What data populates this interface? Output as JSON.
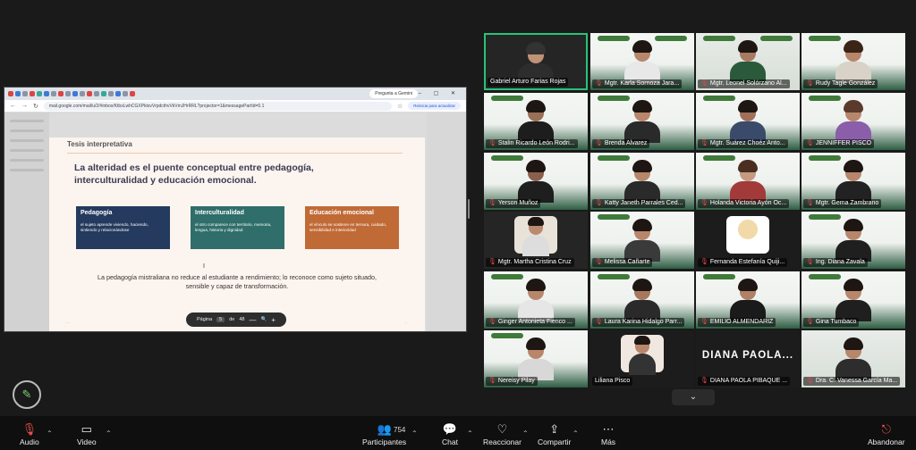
{
  "share": {
    "gemini_label": "Pregunta a Gemini",
    "url": "mail.google.com/mail/u/2/#inbox/KtbxLwhCGXPktsvVrpdcthvVkVmJHrRRL?projector=1&messagePartId=0.1",
    "update_label": "Reinicia para actualizar",
    "slide": {
      "kicker": "Tesis interpretativa",
      "headline": "La alteridad es el puente conceptual entre pedagogía, interculturalidad y educación emocional.",
      "cards": [
        {
          "title": "Pedagogía",
          "text": "el sujeto aprende viviendo, haciendo, sintiendo y relacionándose"
        },
        {
          "title": "Interculturalidad",
          "text": "el otro comparece con territorio, memoria, lengua, historia y dignidad"
        },
        {
          "title": "Educación emocional",
          "text": "el vínculo se sostiene en ternura, cuidado, sensibilidad e interioridad"
        }
      ],
      "footer": "La pedagogía mistraliana no reduce al estudiante a rendimiento; lo reconoce como sujeto situado, sensible y capaz de transformación."
    },
    "pager": {
      "label": "Página",
      "current": "5",
      "of": "de",
      "total": "48",
      "minus": "—",
      "zoom": "🔍",
      "plus": "+"
    }
  },
  "participants": [
    {
      "name": "Gabriel Arturo Farias Rojas",
      "muted": false
    },
    {
      "name": "Mgtr. Karla Sornoza Jara...",
      "muted": true
    },
    {
      "name": "Mgtr. Leonel Solórzano Al...",
      "muted": true
    },
    {
      "name": "Rudy Tagle González",
      "muted": true
    },
    {
      "name": "Stalin Ricardo León Rodri...",
      "muted": true
    },
    {
      "name": "Brenda Alvarez",
      "muted": true
    },
    {
      "name": "Mgtr. Suárez Choéz Anto...",
      "muted": true
    },
    {
      "name": "JENNIFFER PISCO",
      "muted": true
    },
    {
      "name": "Yerson Muñoz",
      "muted": true
    },
    {
      "name": "Katty Janeth Parrales Ced...",
      "muted": true
    },
    {
      "name": "Holanda Victoria Ayón Oc...",
      "muted": true
    },
    {
      "name": "Mgtr. Gema Zambrano",
      "muted": true
    },
    {
      "name": "Mgtr. Martha Cristina Cruz",
      "muted": true
    },
    {
      "name": "Melissa Cañarte",
      "muted": true
    },
    {
      "name": "Fernanda Estefanía Quiji...",
      "muted": true
    },
    {
      "name": "Ing. Diana Zavala",
      "muted": true
    },
    {
      "name": "Ginger Antonieta Fienco ...",
      "muted": true
    },
    {
      "name": "Laura Karina Hidalgo Parr...",
      "muted": true
    },
    {
      "name": "EMILIO ALMENDARIZ",
      "muted": true
    },
    {
      "name": "Gina Tumbaco",
      "muted": true
    },
    {
      "name": "Nereisy Pilay",
      "muted": true
    },
    {
      "name": "Liliana Pisco",
      "muted": false
    },
    {
      "name": "DIANA PAOLA PIBAQUE ...",
      "muted": true,
      "big": "DIANA  PAOLA..."
    },
    {
      "name": "Dra. C. Vanessa García Ma...",
      "muted": true
    }
  ],
  "toolbar": {
    "audio": "Audio",
    "video": "Video",
    "participants": "Participantes",
    "participants_count": "754",
    "chat": "Chat",
    "reactions": "Reaccionar",
    "share": "Compartir",
    "more": "Más",
    "leave": "Abandonar"
  }
}
